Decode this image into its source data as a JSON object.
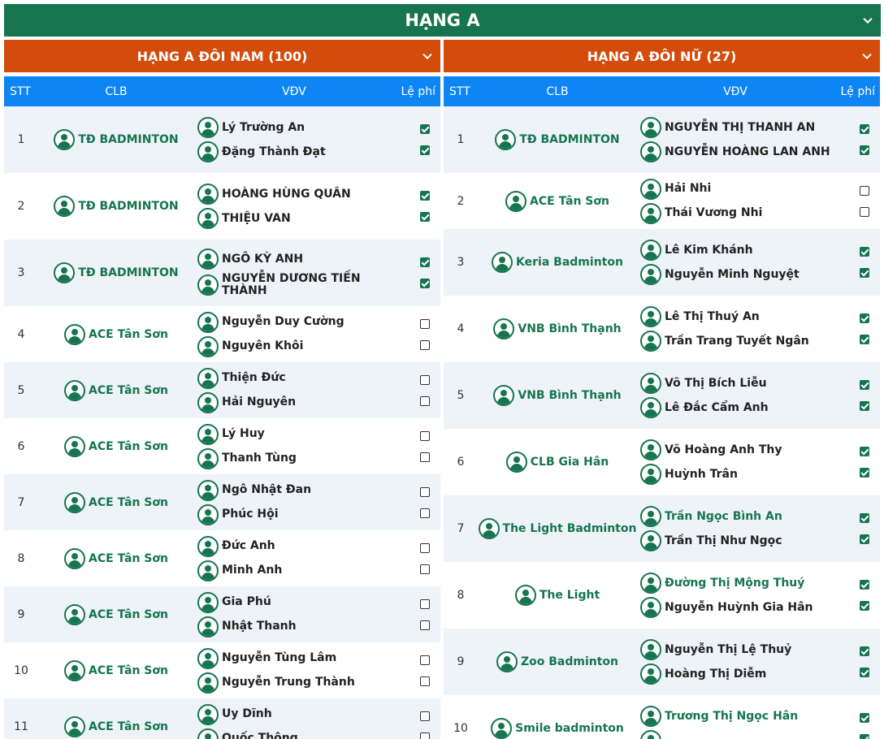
{
  "header": {
    "title": "HẠNG A"
  },
  "left": {
    "title": "HẠNG A ĐÔI NAM (100)",
    "columns": {
      "stt": "STT",
      "clb": "CLB",
      "vdv": "VĐV",
      "fee": "Lệ phí"
    },
    "rows": [
      {
        "stt": "1",
        "club": "TĐ BADMINTON",
        "p1": "Lý Trường An",
        "p2": "Đặng Thành Đạt",
        "f1": true,
        "f2": true
      },
      {
        "stt": "2",
        "club": "TĐ BADMINTON",
        "p1": "HOÀNG HÙNG QUÂN",
        "p2": "THIỆU VAN",
        "f1": true,
        "f2": true
      },
      {
        "stt": "3",
        "club": "TĐ BADMINTON",
        "p1": "NGÔ KỲ ANH",
        "p2": "NGUYỄN DƯƠNG TIẾN THÀNH",
        "f1": true,
        "f2": true
      },
      {
        "stt": "4",
        "club": "ACE Tân Sơn",
        "p1": "Nguyễn Duy Cường",
        "p2": "Nguyên Khôi",
        "f1": false,
        "f2": false
      },
      {
        "stt": "5",
        "club": "ACE Tân Sơn",
        "p1": "Thiện Đức",
        "p2": "Hải Nguyên",
        "f1": false,
        "f2": false
      },
      {
        "stt": "6",
        "club": "ACE Tân Sơn",
        "p1": "Lý Huy",
        "p2": "Thanh Tùng",
        "f1": false,
        "f2": false
      },
      {
        "stt": "7",
        "club": "ACE Tân Sơn",
        "p1": "Ngô Nhật Đan",
        "p2": "Phúc Hội",
        "f1": false,
        "f2": false
      },
      {
        "stt": "8",
        "club": "ACE Tân Sơn",
        "p1": "Đức Anh",
        "p2": "Minh Anh",
        "f1": false,
        "f2": false
      },
      {
        "stt": "9",
        "club": "ACE Tân Sơn",
        "p1": "Gia Phú",
        "p2": "Nhật Thanh",
        "f1": false,
        "f2": false
      },
      {
        "stt": "10",
        "club": "ACE Tân Sơn",
        "p1": "Nguyễn Tùng Lâm",
        "p2": "Nguyễn Trung Thành",
        "f1": false,
        "f2": false
      },
      {
        "stt": "11",
        "club": "ACE Tân Sơn",
        "p1": "Uy Dĩnh",
        "p2": "Quốc Thông",
        "f1": false,
        "f2": false
      }
    ]
  },
  "right": {
    "title": "HẠNG A ĐÔI NỮ (27)",
    "columns": {
      "stt": "STT",
      "clb": "CLB",
      "vdv": "VĐV",
      "fee": "Lệ phí"
    },
    "rows": [
      {
        "stt": "1",
        "club": "TĐ BADMINTON",
        "p1": "NGUYỄN THỊ THANH AN",
        "p2": "NGUYỄN HOÀNG LAN ANH",
        "f1": true,
        "f2": true
      },
      {
        "stt": "2",
        "club": "ACE Tân Sơn",
        "p1": "Hải Nhi",
        "p2": "Thái Vương Nhi",
        "f1": false,
        "f2": false
      },
      {
        "stt": "3",
        "club": "Keria Badminton",
        "p1": "Lê Kim Khánh",
        "p2": "Nguyễn Minh Nguyệt",
        "f1": true,
        "f2": true
      },
      {
        "stt": "4",
        "club": "VNB Bình Thạnh",
        "p1": "Lê Thị Thuý An",
        "p2": "Trần Trang Tuyết Ngân",
        "f1": true,
        "f2": true
      },
      {
        "stt": "5",
        "club": "VNB Bình Thạnh",
        "p1": "Võ Thị Bích Liễu",
        "p2": "Lê Đắc Cẩm Anh",
        "f1": true,
        "f2": true
      },
      {
        "stt": "6",
        "club": "CLB Gia Hân",
        "p1": "Võ Hoàng Anh Thy",
        "p2": "Huỳnh Trân",
        "f1": true,
        "f2": true
      },
      {
        "stt": "7",
        "club": "The Light Badminton",
        "p1": "Trần Ngọc Bình An",
        "p2": "Trần Thị Như Ngọc",
        "f1": true,
        "f2": true,
        "p1green": true
      },
      {
        "stt": "8",
        "club": "The Light",
        "p1": "Đường Thị Mộng Thuý",
        "p2": "Nguyễn Huỳnh Gia Hân",
        "f1": true,
        "f2": true,
        "p1green": true
      },
      {
        "stt": "9",
        "club": "Zoo Badminton",
        "p1": "Nguyễn Thị Lệ Thuỷ",
        "p2": "Hoàng Thị Diễm",
        "f1": true,
        "f2": true
      },
      {
        "stt": "10",
        "club": "Smile badminton",
        "p1": "Trương Thị Ngọc Hân",
        "p2": "",
        "f1": true,
        "f2": true,
        "p1green": true
      }
    ]
  }
}
